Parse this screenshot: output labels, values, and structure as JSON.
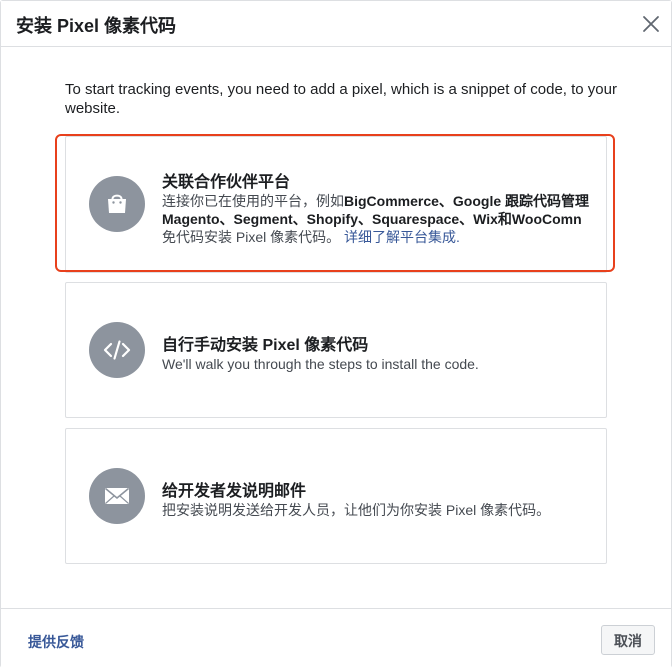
{
  "dialog": {
    "title": "安装 Pixel 像素代码",
    "close_icon": "close-icon",
    "intro": "To start tracking events, you need to add a pixel, which is a snippet of code, to your website."
  },
  "options": [
    {
      "title": "关联合作伙伴平台",
      "icon": "shopping-bag-icon",
      "desc_line1_pre": "连接你已在使用的平台，例如",
      "desc_line1_bold": "BigCommerce、Google 跟踪代码管理",
      "desc_line2_bold": "Magento、Segment、Shopify、Squarespace、Wix和WooComn",
      "desc_line3": "免代码安装 Pixel 像素代码。",
      "link": "详细了解平台集成."
    },
    {
      "title": "自行手动安装 Pixel 像素代码",
      "icon": "code-icon",
      "desc": "We'll walk you through the steps to install the code."
    },
    {
      "title": "给开发者发说明邮件",
      "icon": "envelope-icon",
      "desc": "把安装说明发送给开发人员，让他们为你安装 Pixel 像素代码。"
    }
  ],
  "footer": {
    "feedback": "提供反馈",
    "cancel": "取消"
  },
  "colors": {
    "highlight": "#e8401c",
    "link": "#385898",
    "icon_bg": "#8d949e"
  }
}
